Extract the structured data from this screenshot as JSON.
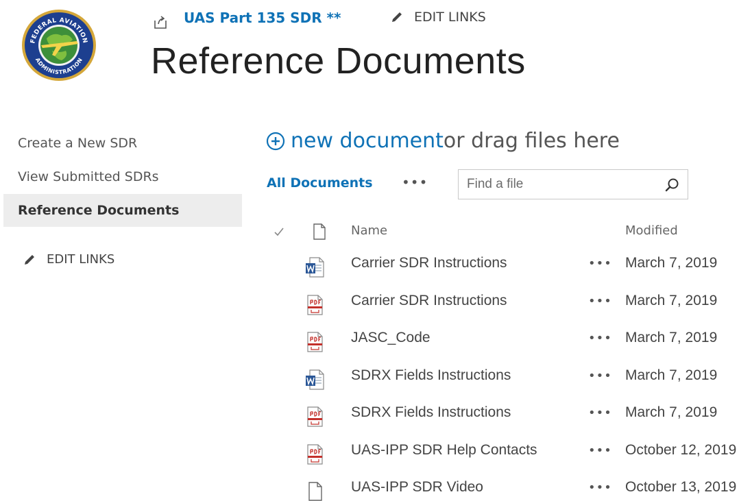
{
  "header": {
    "site_link": "UAS Part 135 SDR **",
    "edit_links": "EDIT LINKS",
    "page_title": "Reference Documents",
    "logo_text_top": "FEDERAL AVIATION",
    "logo_text_bottom": "ADMINISTRATION"
  },
  "nav": {
    "items": [
      {
        "label": "Create a New SDR",
        "selected": false
      },
      {
        "label": "View Submitted SDRs",
        "selected": false
      },
      {
        "label": "Reference Documents",
        "selected": true
      }
    ],
    "edit_links": "EDIT LINKS"
  },
  "commands": {
    "new_document": "new document",
    "drag_text": " or drag files here",
    "view_name": "All Documents",
    "more": "•••",
    "search_placeholder": "Find a file"
  },
  "table": {
    "columns": {
      "name": "Name",
      "modified": "Modified"
    },
    "rows": [
      {
        "icon": "word-doc-icon",
        "name": "Carrier SDR Instructions",
        "modified": "March 7, 2019",
        "more": "•••"
      },
      {
        "icon": "pdf-icon",
        "name": "Carrier SDR Instructions",
        "modified": "March 7, 2019",
        "more": "•••"
      },
      {
        "icon": "pdf-icon",
        "name": "JASC_Code",
        "modified": "March 7, 2019",
        "more": "•••"
      },
      {
        "icon": "word-doc-icon",
        "name": "SDRX Fields Instructions",
        "modified": "March 7, 2019",
        "more": "•••"
      },
      {
        "icon": "pdf-icon",
        "name": "SDRX Fields Instructions",
        "modified": "March 7, 2019",
        "more": "•••"
      },
      {
        "icon": "pdf-icon",
        "name": "UAS-IPP SDR Help Contacts",
        "modified": "October 12, 2019",
        "more": "•••"
      },
      {
        "icon": "generic-file-icon",
        "name": "UAS-IPP SDR Video",
        "modified": "October 13, 2019",
        "more": "•••"
      }
    ]
  },
  "colors": {
    "accent": "#0f72b6",
    "selected_nav_bg": "#ededed",
    "word_blue": "#2b5797",
    "pdf_red": "#c4302b"
  }
}
